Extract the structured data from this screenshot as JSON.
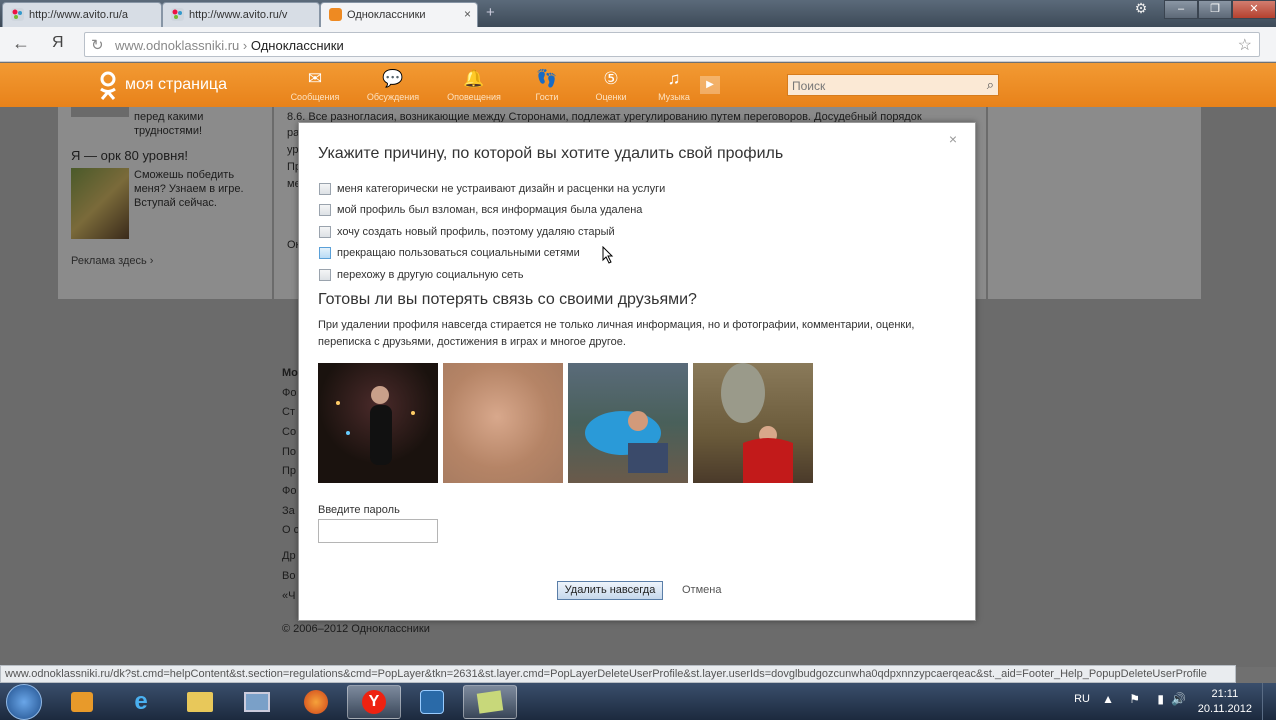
{
  "browser": {
    "tabs": [
      {
        "label": "http://www.avito.ru/a",
        "favicon": "avito-icon",
        "active": false
      },
      {
        "label": "http://www.avito.ru/v",
        "favicon": "avito-icon",
        "active": false
      },
      {
        "label": "Одноклассники",
        "favicon": "odnoklassniki-icon",
        "active": true
      }
    ],
    "close_glyph": "×",
    "new_tab_glyph": "+",
    "yandex_glyph": "Я",
    "address": {
      "domain": "www.odnoklassniki.ru",
      "separator": "›",
      "title": "Одноклассники"
    }
  },
  "site_header": {
    "my_page": "моя страница",
    "nav": [
      {
        "label": "Сообщения",
        "icon": "envelope-icon"
      },
      {
        "label": "Обсуждения",
        "icon": "discussion-icon"
      },
      {
        "label": "Оповещения",
        "icon": "bell-icon"
      },
      {
        "label": "Гости",
        "icon": "footprints-icon"
      },
      {
        "label": "Оценки",
        "icon": "rating-icon"
      },
      {
        "label": "Музыка",
        "icon": "music-icon"
      }
    ],
    "search_placeholder": "Поиск"
  },
  "background": {
    "left_top_text": "перед какими трудностями!",
    "orc_title": "Я — орк 80 уровня!",
    "orc_text": "Сможешь победить меня? Узнаем в игре. Вступай сейчас.",
    "ads_link": "Реклама здесь ›",
    "mid_text": "8.6. Все разногласия, возникающие между Сторонами, подлежат урегулированию путем переговоров. Досудебный порядок",
    "mid_fragments": [
      "ра",
      "ур",
      "Пр",
      "ме",
      "Ок"
    ],
    "footer_fragments": [
      "Мо",
      "Фо",
      "Ст",
      "Со",
      "По",
      "Пр",
      "Фо",
      "За",
      "О с",
      "Др",
      "Во",
      "«Ч"
    ],
    "copyright": "© 2006–2012 Одноклассники"
  },
  "modal": {
    "close": "×",
    "title": "Укажите причину, по которой вы хотите удалить свой профиль",
    "reasons": [
      "меня категорически не устраивают дизайн и расценки на услуги",
      "мой профиль был взломан, вся информация была удалена",
      "хочу создать новый профиль, поэтому удаляю старый",
      "прекращаю пользоваться социальными сетями",
      "перехожу в другую социальную сеть"
    ],
    "friends_title": "Готовы ли вы потерять связь со своими друзьями?",
    "warning": "При удалении профиля навсегда стирается не только личная информация, но и фотографии, комментарии, оценки, переписка с друзьями, достижения в играх и многое другое.",
    "password_label": "Введите пароль",
    "delete_button": "Удалить навсегда",
    "cancel": "Отмена"
  },
  "status_url": "www.odnoklassniki.ru/dk?st.cmd=helpContent&st.section=regulations&cmd=PopLayer&tkn=2631&st.layer.cmd=PopLayerDeleteUserProfile&st.layer.userIds=dovglbudgozcunwha0qdpxnnzypcaerqeac&st._aid=Footer_Help_PopupDeleteUserProfile",
  "taskbar": {
    "apps": [
      "media-player-icon",
      "internet-explorer-icon",
      "file-explorer-icon",
      "remote-desktop-icon",
      "firefox-icon",
      "yandex-browser-icon",
      "app-icon",
      "notes-icon"
    ],
    "lang": "RU",
    "time": "21:11",
    "date": "20.11.2012"
  },
  "colors": {
    "header_orange": "#ee8a22",
    "modal_bg": "#ffffff",
    "overlay": "#6b6b6b"
  }
}
